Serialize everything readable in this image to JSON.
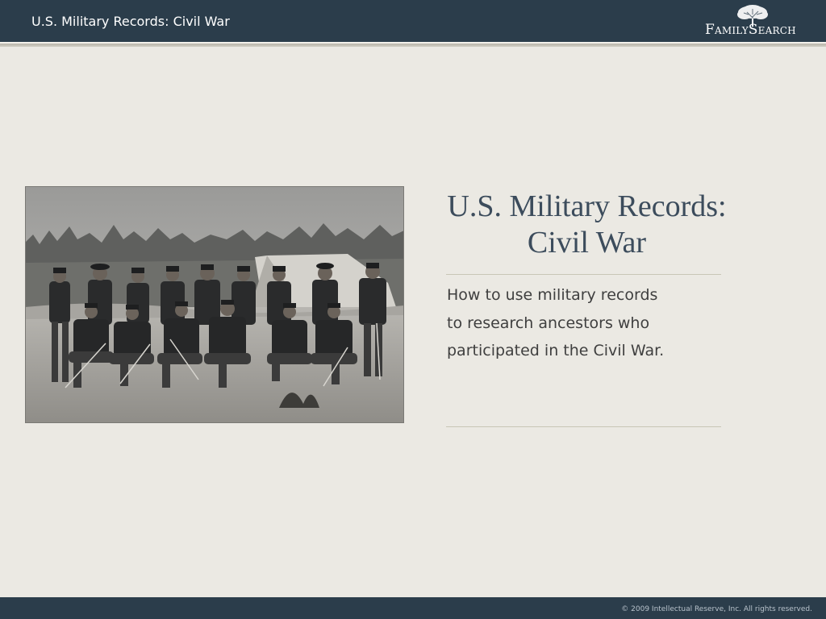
{
  "header": {
    "title": "U.S. Military Records: Civil War",
    "logo_text": "FamilySearch"
  },
  "slide": {
    "title_line1": "U.S. Military Records:",
    "title_line2": "Civil War",
    "subtitle_lines": [
      "How to use military records",
      "to research ancestors who",
      "participated in the Civil War."
    ]
  },
  "footer": {
    "copyright": "© 2009 Intellectual Reserve, Inc. All rights reserved."
  },
  "colors": {
    "bar": "#2b3d4b",
    "background": "#ebe9e3",
    "title": "#3c4c5c"
  }
}
